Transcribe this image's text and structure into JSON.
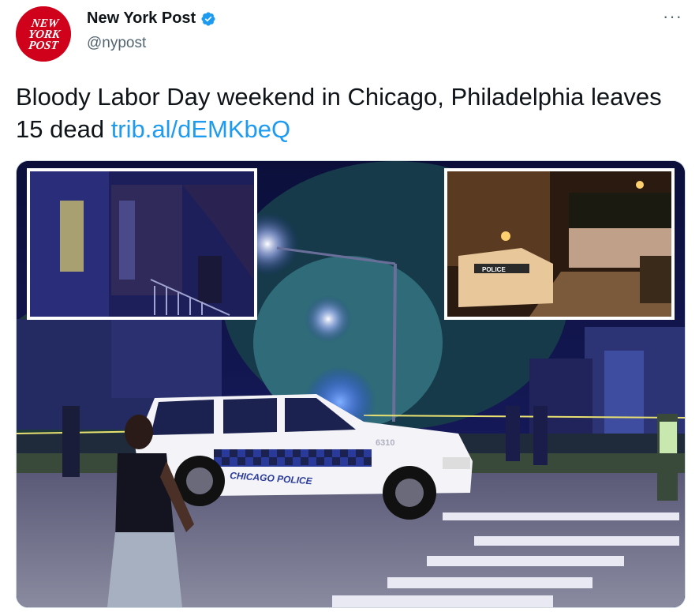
{
  "account": {
    "display_name": "New York Post",
    "handle": "@nypost",
    "avatar_lines": [
      "NEW",
      "YORK",
      "POST"
    ],
    "verified": true
  },
  "tweet": {
    "text": "Bloody Labor Day weekend in Chicago, Philadelphia leaves 15 dead",
    "link": "trib.al/dEMKbeQ"
  },
  "media": {
    "vehicle_text": "CHICAGO POLICE",
    "vehicle_number": "6310",
    "inset_vehicle_text": "POLICE"
  },
  "icons": {
    "verified": "verified-badge-icon",
    "more": "more-options-icon"
  },
  "colors": {
    "brand_red": "#d0021b",
    "link_blue": "#1d9bf0",
    "verified_blue": "#1d9bf0",
    "text_primary": "#0f1419",
    "text_secondary": "#536471"
  }
}
